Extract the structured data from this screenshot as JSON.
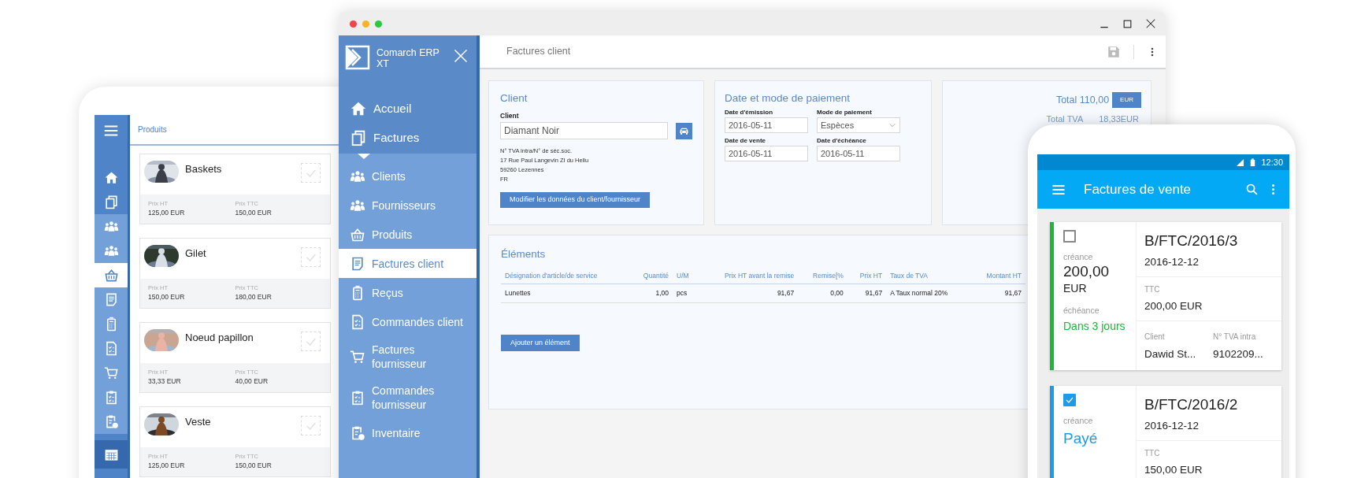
{
  "tablet": {
    "header": "Produits",
    "nav": [
      {
        "kind": "section",
        "selected": false
      },
      {
        "kind": "section",
        "selected": false
      },
      {
        "kind": "sub",
        "selected": false
      },
      {
        "kind": "sub",
        "selected": false
      },
      {
        "kind": "sub",
        "selected": true
      },
      {
        "kind": "sub",
        "selected": false
      },
      {
        "kind": "sub",
        "selected": false
      },
      {
        "kind": "sub",
        "selected": false
      },
      {
        "kind": "sub",
        "selected": false
      },
      {
        "kind": "sub",
        "selected": false
      },
      {
        "kind": "sub",
        "selected": false
      },
      {
        "kind": "footer",
        "selected": false
      }
    ],
    "products": [
      {
        "name": "Baskets",
        "checked": false,
        "prices": [
          {
            "label": "Prix HT",
            "value": "125,00 EUR"
          },
          {
            "label": "Prix TTC",
            "value": "150,00 EUR"
          }
        ]
      },
      {
        "name": "Gilet",
        "checked": false,
        "prices": [
          {
            "label": "Prix HT",
            "value": "150,00 EUR"
          },
          {
            "label": "Prix TTC",
            "value": "180,00 EUR"
          }
        ]
      },
      {
        "name": "Noeud papillon",
        "checked": false,
        "prices": [
          {
            "label": "Prix HT",
            "value": "33,33 EUR"
          },
          {
            "label": "Prix TTC",
            "value": "40,00 EUR"
          }
        ]
      },
      {
        "name": "Veste",
        "checked": false,
        "prices": [
          {
            "label": "Prix HT",
            "value": "125,00 EUR"
          },
          {
            "label": "Prix TTC",
            "value": "150,00 EUR"
          }
        ]
      }
    ]
  },
  "desktop": {
    "app_name": "Comarch ERP XT",
    "sidebar": {
      "items": [
        {
          "label": "Accueil",
          "kind": "section",
          "selected": false
        },
        {
          "label": "Factures",
          "kind": "section",
          "selected": false
        },
        {
          "label": "Clients",
          "kind": "sub",
          "selected": false
        },
        {
          "label": "Fournisseurs",
          "kind": "sub",
          "selected": false
        },
        {
          "label": "Produits",
          "kind": "sub",
          "selected": false
        },
        {
          "label": "Factures client",
          "kind": "sub",
          "selected": true
        },
        {
          "label": "Reçus",
          "kind": "sub",
          "selected": false
        },
        {
          "label": "Commandes client",
          "kind": "sub",
          "selected": false
        },
        {
          "label": "Factures fournisseur",
          "kind": "sub",
          "selected": false
        },
        {
          "label": "Commandes fournisseur",
          "kind": "sub",
          "selected": false
        },
        {
          "label": "Inventaire",
          "kind": "sub",
          "selected": false
        }
      ]
    },
    "page_title": "Factures client",
    "client": {
      "title": "Client",
      "field_label": "Client",
      "value": "Diamant Noir",
      "address": [
        "N° TVA intra/N° de séc.soc.",
        "17 Rue Paul Langevin ZI du Hellu",
        "59260 Lezennes",
        "FR"
      ],
      "button": "Modifier les données du client/fournisseur"
    },
    "payment": {
      "title": "Date et mode de paiement",
      "fields": [
        {
          "label": "Date d'émission",
          "value": "2016-05-11",
          "kind": "text"
        },
        {
          "label": "Mode de paiement",
          "value": "Espèces",
          "kind": "select"
        },
        {
          "label": "Date de vente",
          "value": "2016-05-11",
          "kind": "text"
        },
        {
          "label": "Date d'échéance",
          "value": "2016-05-11",
          "kind": "text"
        }
      ]
    },
    "totals": {
      "total_label": "Total 110,00",
      "currency": "EUR",
      "vat_label": "Total TVA",
      "vat_value": "18,33EUR"
    },
    "elements": {
      "title": "Éléments",
      "table": {
        "columns": [
          "Désignation d'article/de service",
          "Quantité",
          "U/M",
          "Prix HT avant la remise",
          "Remise[%",
          "Prix HT",
          "Taux de TVA",
          "Montant HT"
        ],
        "rows": [
          [
            "Lunettes",
            "1,00",
            "pcs",
            "91,67",
            "0,00",
            "91,67",
            "A Taux normal 20%",
            "91,67"
          ]
        ]
      },
      "button": "Ajouter un élément"
    }
  },
  "phone": {
    "time": "12:30",
    "title": "Factures de vente",
    "invoices": [
      {
        "checked": false,
        "color": "#1db83a",
        "number": "B/FTC/2016/3",
        "date": "2016-12-12",
        "ttc_label": "TTC",
        "ttc": "200,00 EUR",
        "left": [
          {
            "kind": "label",
            "text": "créance"
          },
          {
            "kind": "amount",
            "text": "200,00"
          },
          {
            "kind": "currency",
            "text": "EUR"
          },
          {
            "kind": "label",
            "text": "échéance"
          },
          {
            "kind": "status",
            "text": "Dans 3 jours"
          }
        ],
        "details": [
          {
            "label": "Client",
            "value": "Dawid St..."
          },
          {
            "label": "N° TVA intra",
            "value": "9102209..."
          }
        ]
      },
      {
        "checked": true,
        "color": "#1e9be8",
        "number": "B/FTC/2016/2",
        "date": "2016-12-12",
        "ttc_label": "TTC",
        "ttc": "150,00 EUR",
        "left": [
          {
            "kind": "label",
            "text": "créance"
          },
          {
            "kind": "bigstatus",
            "text": "Payé"
          }
        ]
      }
    ]
  }
}
